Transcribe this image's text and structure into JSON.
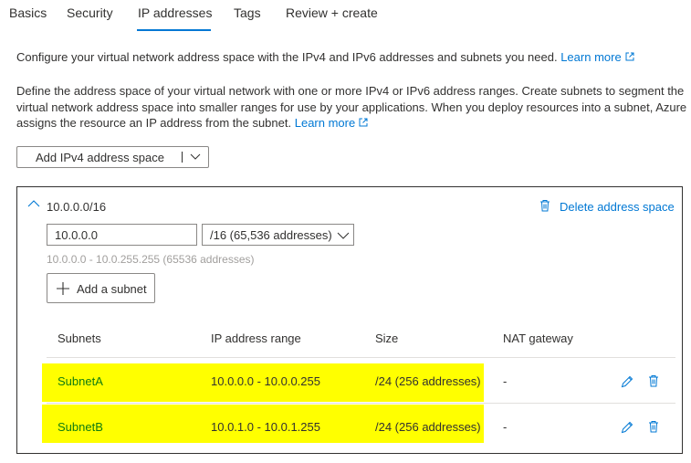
{
  "tabs": [
    {
      "label": "Basics"
    },
    {
      "label": "Security"
    },
    {
      "label": "IP addresses"
    },
    {
      "label": "Tags"
    },
    {
      "label": "Review + create"
    }
  ],
  "active_tab": "IP addresses",
  "intro": {
    "text": "Configure your virtual network address space with the IPv4 and IPv6 addresses and subnets you need.",
    "link": "Learn more"
  },
  "details": {
    "line1": "Define the address space of your virtual network with one or more IPv4 or IPv6 address ranges. Create subnets to segment the",
    "line2": "virtual network address space into smaller ranges for use by your applications. When you deploy resources into a subnet, Azure",
    "line3": "assigns the resource an IP address from the subnet.",
    "link": "Learn more"
  },
  "add_space_button": "Add IPv4 address space",
  "address_space": {
    "title": "10.0.0.0/16",
    "delete_label": "Delete address space",
    "address_value": "10.0.0.0",
    "cidr_value": "/16 (65,536 addresses)",
    "range_hint": "10.0.0.0 - 10.0.255.255 (65536 addresses)",
    "add_subnet_label": "Add a subnet"
  },
  "subnet_table": {
    "headers": [
      "Subnets",
      "IP address range",
      "Size",
      "NAT gateway"
    ],
    "rows": [
      {
        "name": "SubnetA",
        "range": "10.0.0.0 - 10.0.0.255",
        "size": "/24 (256 addresses)",
        "nat": "-"
      },
      {
        "name": "SubnetB",
        "range": "10.0.1.0 - 10.0.1.255",
        "size": "/24 (256 addresses)",
        "nat": "-"
      }
    ]
  },
  "colors": {
    "accent": "#0078d4",
    "subnet_link": "#107c10",
    "highlight": "#ffff00"
  },
  "icons": [
    "external-link-icon",
    "chevron-down-icon",
    "chevron-up-icon",
    "trash-icon",
    "plus-icon",
    "edit-icon"
  ]
}
